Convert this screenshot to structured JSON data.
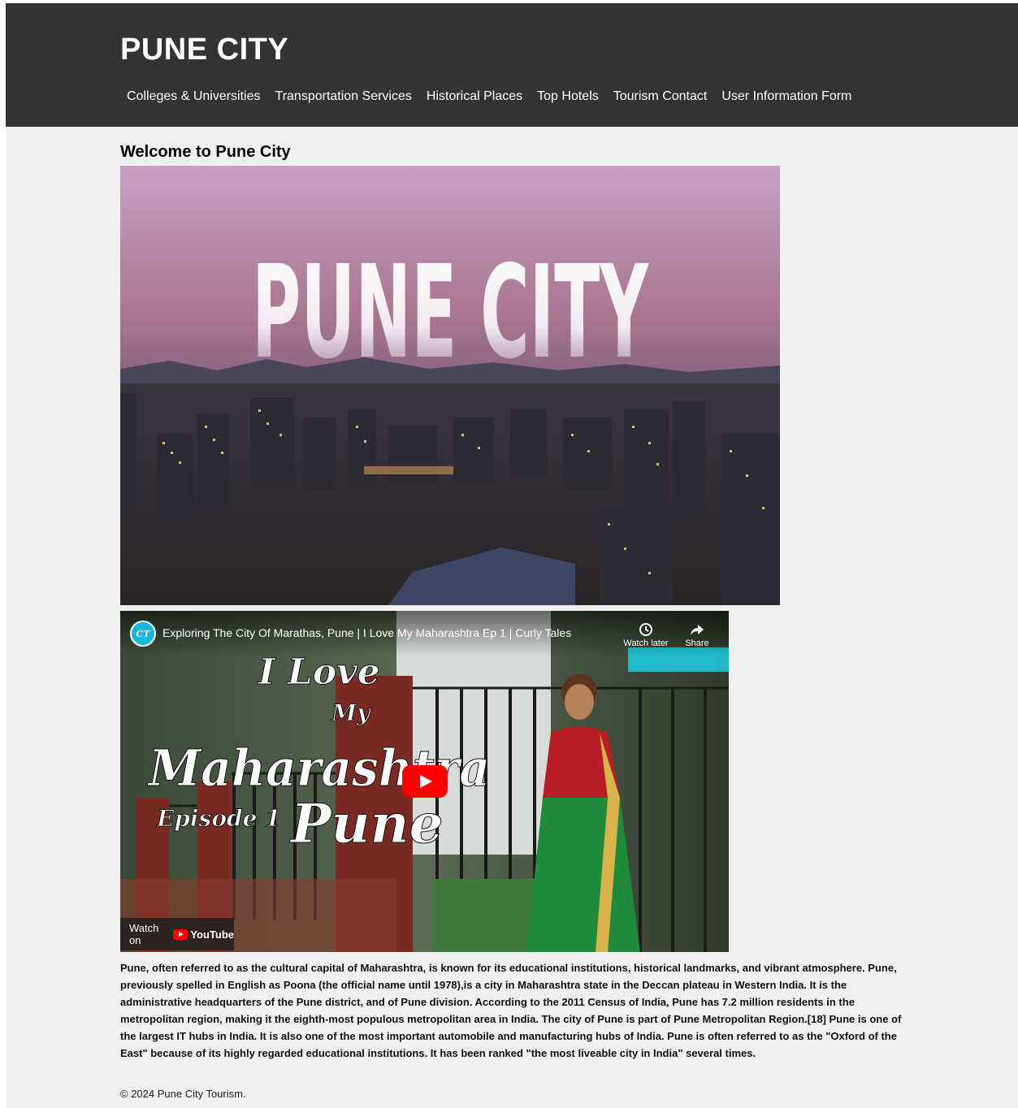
{
  "header": {
    "title": "PUNE CITY",
    "nav": [
      {
        "label": "Colleges & Universities"
      },
      {
        "label": "Transportation Services"
      },
      {
        "label": "Historical Places"
      },
      {
        "label": "Top Hotels"
      },
      {
        "label": "Tourism Contact"
      },
      {
        "label": "User Information Form"
      }
    ]
  },
  "main": {
    "heading": "Welcome to Pune City",
    "hero_image": {
      "overlay_text": "PUNE CITY"
    },
    "video": {
      "title": "Exploring The City Of Marathas, Pune | I Love My Maharashtra Ep 1 | Curly Tales",
      "watch_later_label": "Watch later",
      "share_label": "Share",
      "watch_on_label": "Watch on",
      "youtube_label": "YouTube",
      "thumbnail_lines": [
        "I Love",
        "My",
        "Maharashtra",
        "Episode 1",
        "Pune"
      ]
    },
    "description": "Pune, often referred to as the cultural capital of Maharashtra, is known for its educational institutions, historical landmarks, and vibrant atmosphere. Pune, previously spelled in English as Poona (the official name until 1978),is a city in Maharashtra state in the Deccan plateau in Western India. It is the administrative headquarters of the Pune district, and of Pune division. According to the 2011 Census of India, Pune has 7.2 million residents in the metropolitan region, making it the eighth-most populous metropolitan area in India. The city of Pune is part of Pune Metropolitan Region.[18] Pune is one of the largest IT hubs in India. It is also one of the most important automobile and manufacturing hubs of India. Pune is often referred to as the \"Oxford of the East\" because of its highly regarded educational institutions. It has been ranked \"the most liveable city in India\" several times."
  },
  "footer": {
    "text": "© 2024 Pune City Tourism."
  },
  "colors": {
    "header_bg": "#333333",
    "page_bg": "#f0f0f0",
    "youtube_red": "#ff0000",
    "channel_accent": "#16b8d6"
  }
}
